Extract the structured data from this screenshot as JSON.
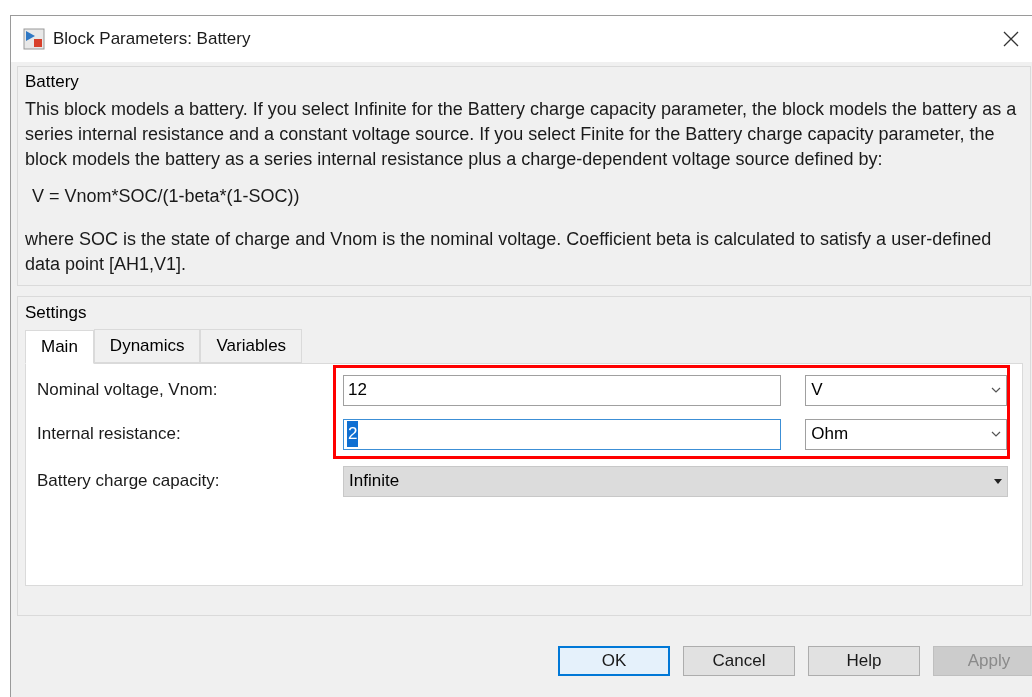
{
  "window": {
    "title": "Block Parameters: Battery"
  },
  "description": {
    "title": "Battery",
    "paragraphs": [
      "This block models a battery. If you select Infinite for the Battery charge capacity parameter, the block models the battery as a series internal resistance and a constant voltage source. If you select Finite for the Battery charge capacity parameter, the block models the battery as a series internal resistance plus a charge-dependent voltage source defined by:",
      "V = Vnom*SOC/(1-beta*(1-SOC))",
      "where SOC is the state of charge and Vnom is the nominal voltage. Coefficient beta is calculated to satisfy a user-defined data point [AH1,V1]."
    ]
  },
  "settings": {
    "title": "Settings",
    "tabs": [
      {
        "label": "Main",
        "selected": true
      },
      {
        "label": "Dynamics",
        "selected": false
      },
      {
        "label": "Variables",
        "selected": false
      }
    ],
    "parameters": [
      {
        "kind": "unit_field",
        "label": "Nominal voltage, Vnom:",
        "value": "12",
        "unit": "V",
        "focused": false,
        "highlighted": true
      },
      {
        "kind": "unit_field",
        "label": "Internal resistance:",
        "value": "2",
        "unit": "Ohm",
        "focused": true,
        "highlighted": true
      },
      {
        "kind": "dropdown",
        "label": "Battery charge capacity:",
        "value": "Infinite",
        "highlighted": false
      }
    ]
  },
  "buttons": [
    {
      "label": "OK",
      "default": true,
      "disabled": false
    },
    {
      "label": "Cancel",
      "default": false,
      "disabled": false
    },
    {
      "label": "Help",
      "default": false,
      "disabled": false
    },
    {
      "label": "Apply",
      "default": false,
      "disabled": true
    }
  ]
}
